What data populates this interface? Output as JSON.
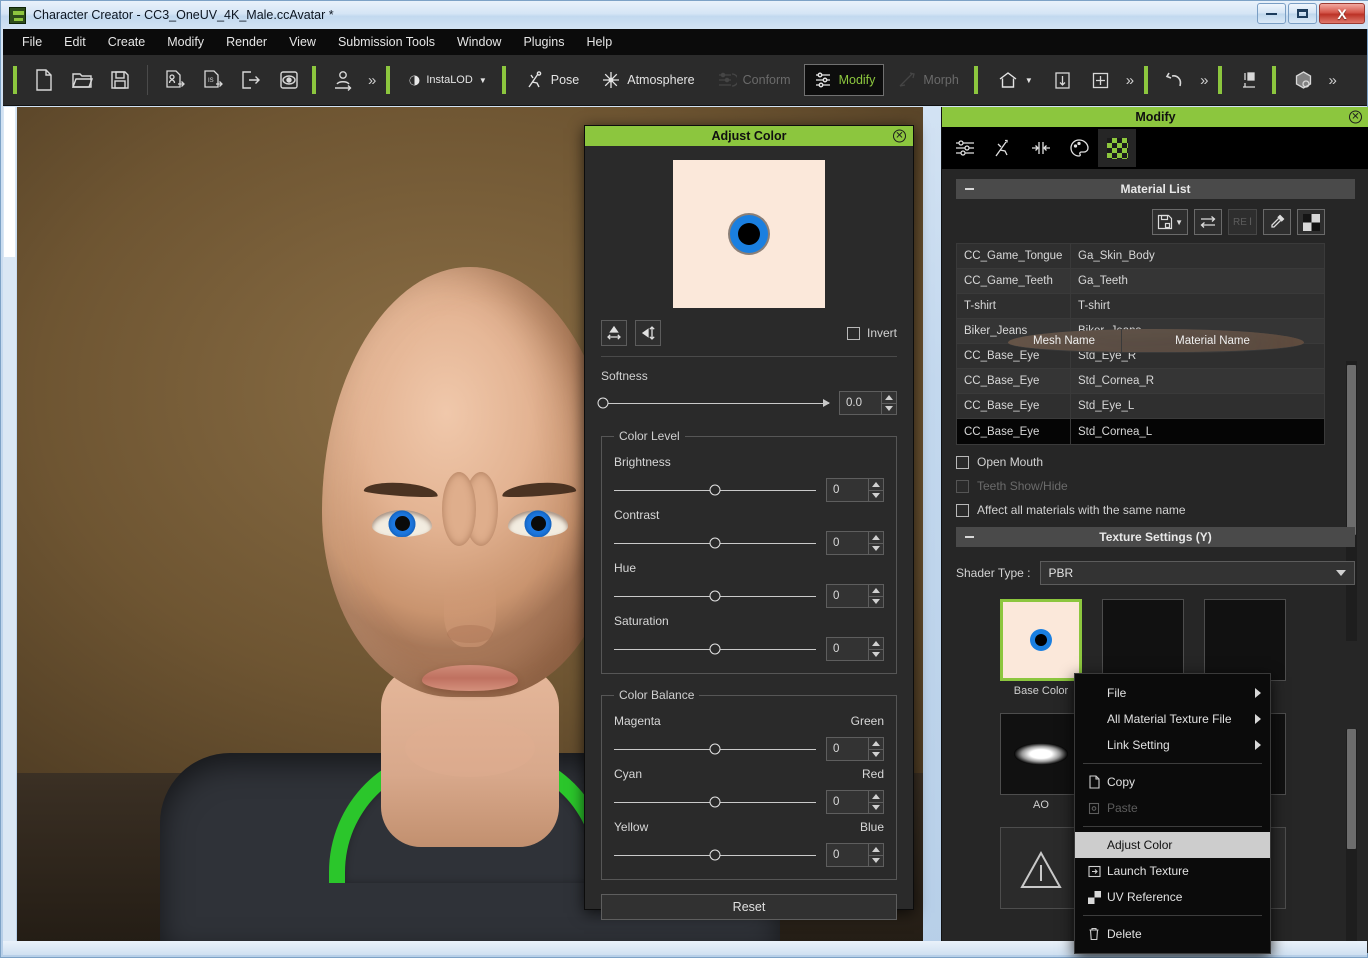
{
  "window": {
    "title": "Character Creator - CC3_OneUV_4K_Male.ccAvatar *",
    "minimize_label": "Minimize",
    "restore_label": "Restore",
    "close_label": "X",
    "accent_green": "#8cc63e"
  },
  "menubar": {
    "items": [
      {
        "label": "File"
      },
      {
        "label": "Edit"
      },
      {
        "label": "Create"
      },
      {
        "label": "Modify"
      },
      {
        "label": "Render"
      },
      {
        "label": "View"
      },
      {
        "label": "Submission Tools"
      },
      {
        "label": "Window"
      },
      {
        "label": "Plugins"
      },
      {
        "label": "Help"
      }
    ]
  },
  "toolbar": {
    "instalod_label": "InstaLOD",
    "pose_label": "Pose",
    "atmosphere_label": "Atmosphere",
    "conform_label": "Conform",
    "modify_label": "Modify",
    "morph_label": "Morph",
    "overflow_label": "»"
  },
  "dialog": {
    "title": "Adjust Color",
    "close_label": "⊗",
    "invert_label": "Invert",
    "softness": {
      "label": "Softness",
      "value": "0.0"
    },
    "color_level": {
      "legend": "Color Level",
      "rows": [
        {
          "label": "Brightness",
          "value": "0"
        },
        {
          "label": "Contrast",
          "value": "0"
        },
        {
          "label": "Hue",
          "value": "0"
        },
        {
          "label": "Saturation",
          "value": "0"
        }
      ]
    },
    "color_balance": {
      "legend": "Color Balance",
      "rows": [
        {
          "left": "Magenta",
          "right": "Green",
          "value": "0"
        },
        {
          "left": "Cyan",
          "right": "Red",
          "value": "0"
        },
        {
          "left": "Yellow",
          "right": "Blue",
          "value": "0"
        }
      ]
    },
    "reset_label": "Reset"
  },
  "panel": {
    "title": "Modify",
    "close_label": "⊗",
    "material_list": {
      "header": "Material List",
      "columns": [
        "Mesh Name",
        "Material Name"
      ],
      "rows": [
        {
          "mesh": "CC_Game_Tongue",
          "material": "Ga_Skin_Body",
          "selected": false
        },
        {
          "mesh": "CC_Game_Teeth",
          "material": "Ga_Teeth",
          "selected": false
        },
        {
          "mesh": "T-shirt",
          "material": "T-shirt",
          "selected": false
        },
        {
          "mesh": "Biker_Jeans",
          "material": "Biker_Jeans",
          "selected": false
        },
        {
          "mesh": "CC_Base_Eye",
          "material": "Std_Eye_R",
          "selected": false
        },
        {
          "mesh": "CC_Base_Eye",
          "material": "Std_Cornea_R",
          "selected": false
        },
        {
          "mesh": "CC_Base_Eye",
          "material": "Std_Eye_L",
          "selected": false
        },
        {
          "mesh": "CC_Base_Eye",
          "material": "Std_Cornea_L",
          "selected": true
        }
      ],
      "rename_label": "RE"
    },
    "checkboxes": [
      {
        "label": "Open Mouth",
        "checked": false,
        "disabled": false
      },
      {
        "label": "Teeth Show/Hide",
        "checked": false,
        "disabled": true
      },
      {
        "label": "Affect all materials with the same name",
        "checked": false,
        "disabled": false
      }
    ],
    "texture_settings": {
      "header": "Texture Settings  (Y)",
      "shader_label": "Shader Type :",
      "shader_value": "PBR",
      "slots": [
        {
          "caption": "Base Color",
          "kind": "base-color",
          "selected": true
        },
        {
          "caption": "",
          "kind": "hidden",
          "selected": false
        },
        {
          "caption": "",
          "kind": "hidden",
          "selected": false
        },
        {
          "caption": "AO",
          "kind": "ao",
          "selected": false
        },
        {
          "caption": "",
          "kind": "hidden",
          "selected": false
        },
        {
          "caption": "",
          "kind": "hidden",
          "selected": false
        },
        {
          "caption": "",
          "kind": "placeholder",
          "selected": false
        },
        {
          "caption": "",
          "kind": "placeholder",
          "selected": false
        },
        {
          "caption": "",
          "kind": "placeholder",
          "selected": false
        }
      ]
    }
  },
  "context_menu": {
    "items": [
      {
        "label": "File",
        "submenu": true,
        "icon": "",
        "disabled": false,
        "highlight": false
      },
      {
        "label": "All Material Texture File",
        "submenu": true,
        "icon": "",
        "disabled": false,
        "highlight": false
      },
      {
        "label": "Link Setting",
        "submenu": true,
        "icon": "",
        "disabled": false,
        "highlight": false
      },
      {
        "separator": true
      },
      {
        "label": "Copy",
        "submenu": false,
        "icon": "copy-icon",
        "disabled": false,
        "highlight": false
      },
      {
        "label": "Paste",
        "submenu": false,
        "icon": "paste-icon",
        "disabled": true,
        "highlight": false
      },
      {
        "separator": true
      },
      {
        "label": "Adjust Color",
        "submenu": false,
        "icon": "",
        "disabled": false,
        "highlight": true
      },
      {
        "separator": false
      },
      {
        "label": "Launch Texture",
        "submenu": false,
        "icon": "launch-icon",
        "disabled": false,
        "highlight": false
      },
      {
        "label": "UV Reference",
        "submenu": false,
        "icon": "uv-icon",
        "disabled": false,
        "highlight": false
      },
      {
        "separator": true
      },
      {
        "label": "Delete",
        "submenu": false,
        "icon": "trash-icon",
        "disabled": false,
        "highlight": false
      }
    ]
  }
}
